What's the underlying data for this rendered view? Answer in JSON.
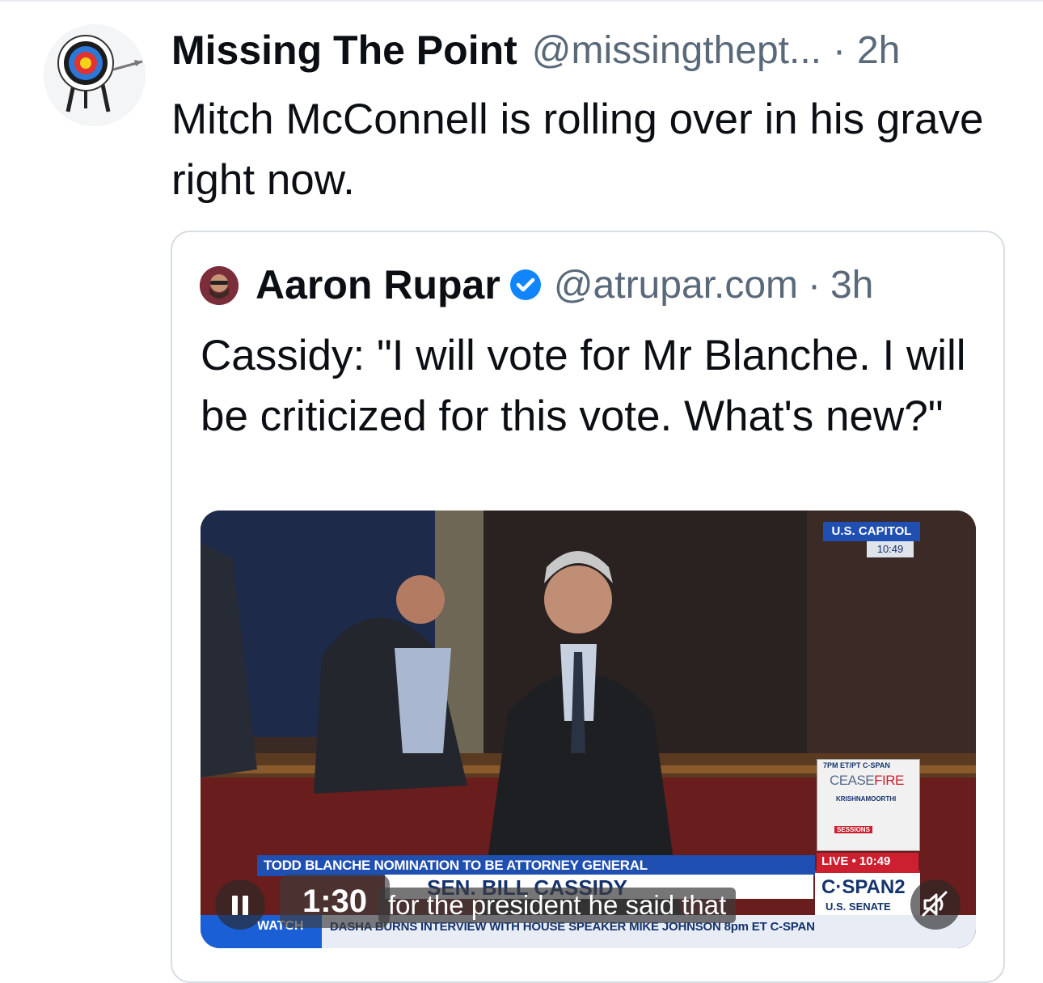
{
  "post": {
    "author_name": "Missing The Point",
    "handle": "@missingthept...",
    "separator": "·",
    "time": "2h",
    "text": "Mitch McConnell is rolling over in his grave right now.",
    "avatar_icon": "archery-target-icon"
  },
  "quote": {
    "author_name": "Aaron Rupar",
    "verified": true,
    "handle": "@atrupar.com",
    "separator": "·",
    "time": "3h",
    "text": "Cassidy: \"I will vote for Mr Blanche. I will be criticized for this vote. What's new?\"",
    "video": {
      "timestamp": "1:30",
      "caption": "for the president he said that",
      "state": "playing",
      "muted": true,
      "broadcast": {
        "location": "U.S. CAPITOL",
        "clock": "10:49",
        "lower_third_headline": "TODD BLANCHE NOMINATION TO BE ATTORNEY GENERAL",
        "lower_third_name": "SEN. BILL CASSIDY",
        "ticker_label": "WATCH",
        "ticker": "DASHA BURNS INTERVIEW WITH HOUSE SPEAKER MIKE JOHNSON  8pm ET  C-SPAN",
        "live_label": "LIVE • 10:49",
        "network": "C·SPAN2",
        "network_sub": "U.S. SENATE",
        "promo_time": "7PM ET/PT C-SPAN",
        "promo_title_a": "CEASE",
        "promo_title_b": "FIRE",
        "promo_guest": "KRISHNAMOORTHI",
        "promo_guest_2": "SESSIONS"
      }
    }
  },
  "colors": {
    "text": "#0b0f14",
    "muted": "#59697a",
    "border": "#d8dee4",
    "verified": "#1185fe",
    "cspan_blue": "#1f4fb0",
    "cspan_red": "#cc1f2f"
  }
}
